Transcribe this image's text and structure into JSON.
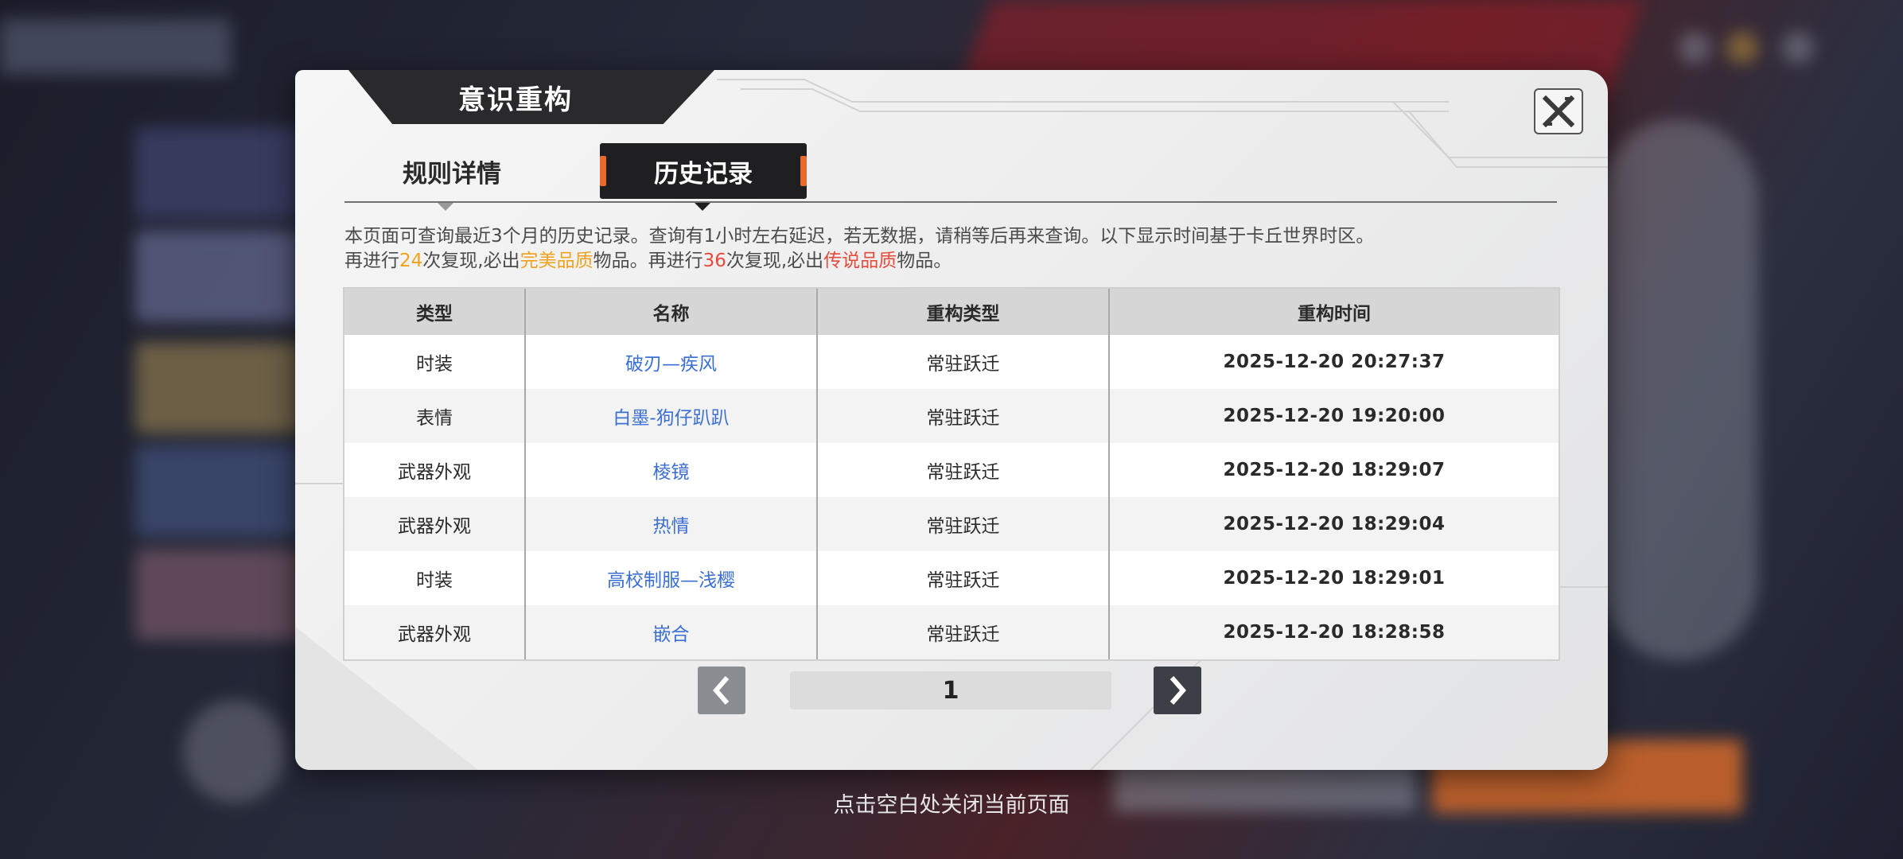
{
  "dialog": {
    "title": "意识重构",
    "tabs": [
      {
        "label": "规则详情",
        "active": false
      },
      {
        "label": "历史记录",
        "active": true
      }
    ],
    "notice": {
      "line1": "本页面可查询最近3个月的历史记录。查询有1小时左右延迟，若无数据，请稍等后再来查询。以下显示时间基于卡丘世界时区。",
      "line2_part1": "再进行",
      "count1": "24",
      "line2_part2": "次复现,必出",
      "quality1": "完美品质",
      "line2_part3": "物品。再进行",
      "count2": "36",
      "line2_part4": "次复现,必出",
      "quality2": "传说品质",
      "line2_part5": "物品。"
    },
    "table": {
      "headers": [
        "类型",
        "名称",
        "重构类型",
        "重构时间"
      ],
      "rows": [
        {
          "type": "时装",
          "name": "破刃—疾风",
          "rtype": "常驻跃迁",
          "time": "2025-12-20   20:27:37"
        },
        {
          "type": "表情",
          "name": "白墨-狗仔趴趴",
          "rtype": "常驻跃迁",
          "time": "2025-12-20   19:20:00"
        },
        {
          "type": "武器外观",
          "name": "棱镜",
          "rtype": "常驻跃迁",
          "time": "2025-12-20   18:29:07"
        },
        {
          "type": "武器外观",
          "name": "热情",
          "rtype": "常驻跃迁",
          "time": "2025-12-20   18:29:04"
        },
        {
          "type": "时装",
          "name": "高校制服—浅樱",
          "rtype": "常驻跃迁",
          "time": "2025-12-20   18:29:01"
        },
        {
          "type": "武器外观",
          "name": "嵌合",
          "rtype": "常驻跃迁",
          "time": "2025-12-20   18:28:58"
        }
      ]
    },
    "pager": {
      "page": "1",
      "prev_icon": "chevron-left-icon",
      "next_icon": "chevron-right-icon"
    },
    "close_icon": "close-icon"
  },
  "hint": "点击空白处关闭当前页面",
  "colors": {
    "accent_orange": "#e86a2c",
    "link_blue": "#3b6fd4",
    "perfect": "#f0a21e",
    "legendary": "#e84a3c"
  }
}
